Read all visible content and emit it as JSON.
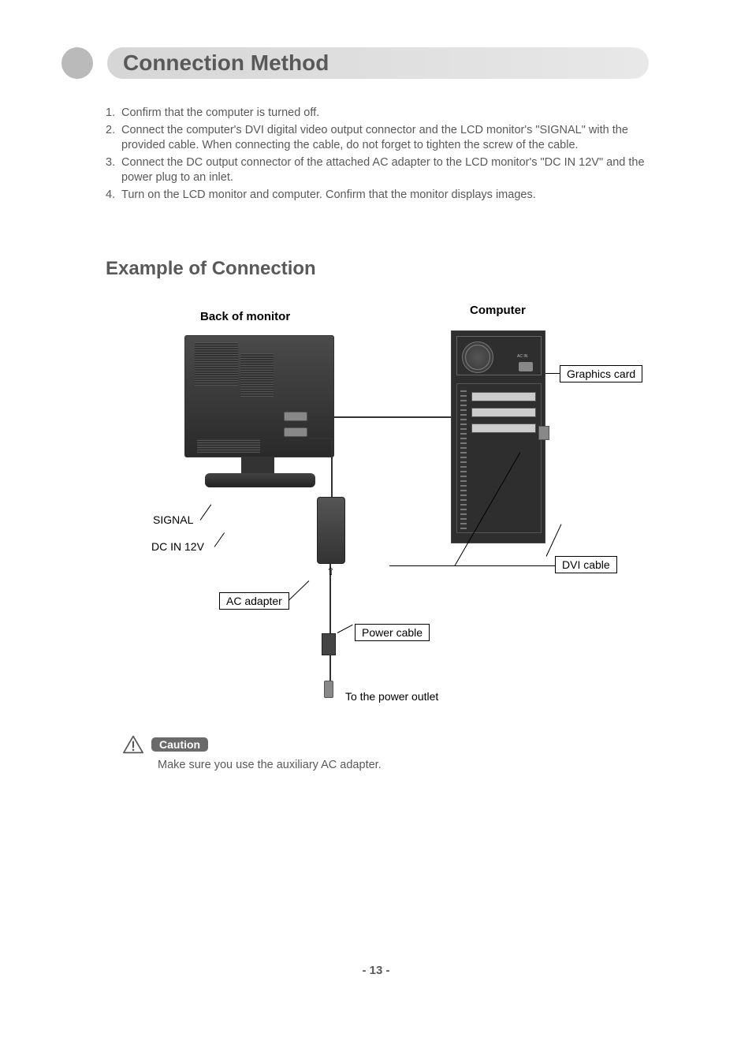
{
  "title": "Connection Method",
  "steps": [
    "Confirm that the computer is turned off.",
    "Connect the computer's DVI digital video output connector and the LCD monitor's \"SIGNAL\" with the provided cable. When connecting the cable, do not forget to tighten the screw of the cable.",
    "Connect the DC output connector of the attached AC adapter to the LCD  monitor's \"DC IN 12V\" and the power plug to an inlet.",
    "Turn on the LCD monitor and computer. Confirm that the monitor displays images."
  ],
  "subtitle": "Example of Connection",
  "diagram": {
    "monitor_label": "Back of monitor",
    "computer_label": "Computer",
    "graphics_card": "Graphics card",
    "signal": "SIGNAL",
    "dc_in": "DC IN 12V",
    "ac_adapter": "AC adapter",
    "power_cable": "Power cable",
    "dvi_cable": "DVI cable",
    "to_outlet": "To the power outlet",
    "ac_in_tiny": "AC IN"
  },
  "caution_label": "Caution",
  "caution_text": "Make sure you use the auxiliary AC adapter.",
  "page_number": "- 13 -"
}
